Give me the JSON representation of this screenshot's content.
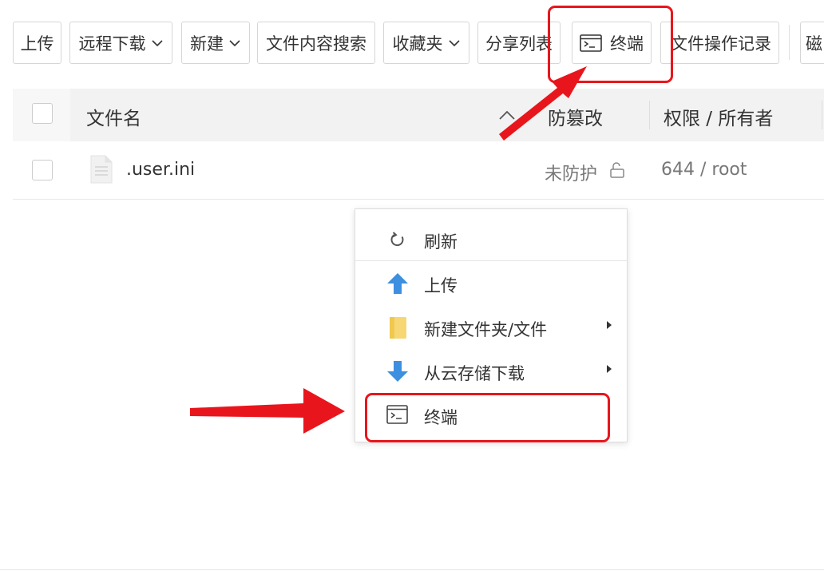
{
  "toolbar": {
    "upload": "上传",
    "remote_download": "远程下载",
    "new": "新建",
    "content_search": "文件内容搜索",
    "favorites": "收藏夹",
    "share_list": "分享列表",
    "terminal": "终端",
    "operation_log": "文件操作记录",
    "disk": "磁"
  },
  "table": {
    "columns": {
      "name": "文件名",
      "tamper": "防篡改",
      "permission": "权限 / 所有者"
    },
    "rows": [
      {
        "name": ".user.ini",
        "tamper": "未防护",
        "permission": "644 / root"
      }
    ]
  },
  "context_menu": {
    "refresh": "刷新",
    "upload": "上传",
    "new_folder_file": "新建文件夹/文件",
    "cloud_download": "从云存储下载",
    "terminal": "终端"
  },
  "colors": {
    "highlight": "#e8161c",
    "upload_arrow": "#3d8fe0",
    "folder": "#f7d774"
  },
  "icons": [
    "chevron-down-icon",
    "terminal-icon",
    "sort-icon",
    "file-icon",
    "unlock-icon",
    "refresh-icon",
    "upload-arrow-icon",
    "folder-icon",
    "download-arrow-icon",
    "submenu-arrow-icon"
  ]
}
